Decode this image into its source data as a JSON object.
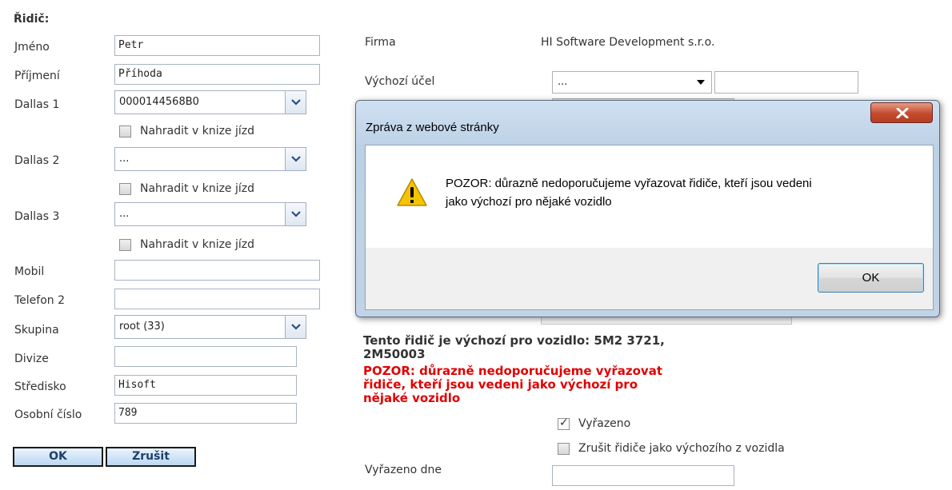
{
  "driver_form": {
    "section_title": "Řidič:",
    "fields": {
      "jmeno": {
        "label": "Jméno",
        "value": "Petr"
      },
      "prijmeni": {
        "label": "Příjmení",
        "value": "Příhoda"
      },
      "dallas1": {
        "label": "Dallas 1",
        "value": "0000144568B0"
      },
      "dallas2": {
        "label": "Dallas 2",
        "value": "..."
      },
      "dallas3": {
        "label": "Dallas 3",
        "value": "..."
      },
      "mobil": {
        "label": "Mobil",
        "value": ""
      },
      "telefon2": {
        "label": "Telefon 2",
        "value": ""
      },
      "skupina": {
        "label": "Skupina",
        "value": "root (33)"
      },
      "divize": {
        "label": "Divize",
        "value": ""
      },
      "stredisko": {
        "label": "Středisko",
        "value": "Hisoft"
      },
      "osobni_cislo": {
        "label": "Osobní číslo",
        "value": "789"
      }
    },
    "replace_checkbox_label": "Nahradit v knize jízd",
    "replace_checked": [
      false,
      false,
      false
    ],
    "buttons": {
      "ok": "OK",
      "cancel": "Zrušit"
    }
  },
  "right_panel": {
    "firma_label": "Firma",
    "firma_value": "HI Software Development s.r.o.",
    "vychozi_ucel_label": "Výchozí účel",
    "vychozi_ucel_value": "...",
    "info_bold": "Tento řidič je výchozí pro vozidlo: 5M2 3721, 2M50003",
    "warning_red": "POZOR: důrazně nedoporučujeme vyřazovat řidiče, kteří jsou vedeni jako výchozí pro nějaké vozidlo",
    "vyrazeno_label": "Vyřazeno",
    "vyrazeno_checked": true,
    "zrusit_ridice_label": "Zrušit řidiče jako výchozího z vozidla",
    "zrusit_ridice_checked": false,
    "vyrazeno_dne_label": "Vyřazeno dne",
    "vyrazeno_dne_value": ""
  },
  "dialog": {
    "title": "Zpráva z webové stránky",
    "message_line1": "POZOR: důrazně nedoporučujeme vyřazovat řidiče, kteří jsou vedeni",
    "message_line2": "jako výchozí pro nějaké vozidlo",
    "ok_label": "OK",
    "icon": "warning-icon"
  }
}
